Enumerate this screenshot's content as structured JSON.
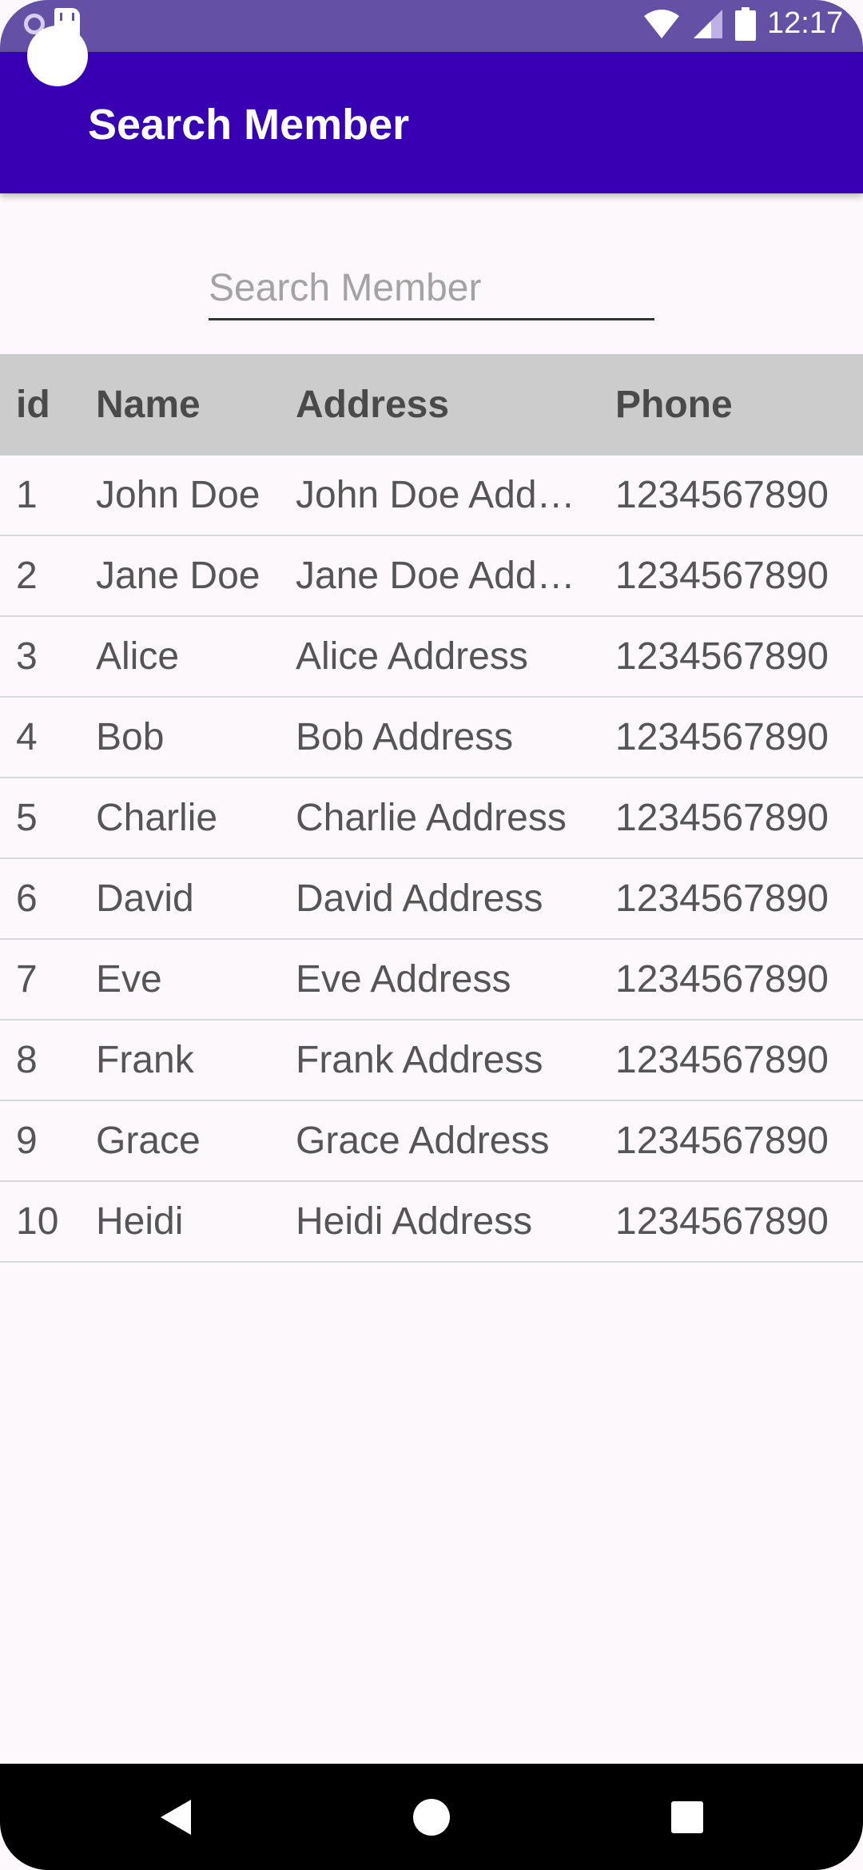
{
  "status_bar": {
    "time": "12:17",
    "icons": [
      "sync-icon",
      "sd-card-icon",
      "wifi-icon",
      "cellular-signal-icon",
      "battery-icon"
    ]
  },
  "app_bar": {
    "title": "Search Member"
  },
  "search": {
    "placeholder": "Search Member",
    "value": ""
  },
  "table": {
    "columns": [
      "id",
      "Name",
      "Address",
      "Phone"
    ],
    "rows": [
      {
        "id": "1",
        "name": "John Doe",
        "address": "John Doe Address",
        "phone": "1234567890"
      },
      {
        "id": "2",
        "name": "Jane Doe",
        "address": "Jane Doe Address",
        "phone": "1234567890"
      },
      {
        "id": "3",
        "name": "Alice",
        "address": "Alice Address",
        "phone": "1234567890"
      },
      {
        "id": "4",
        "name": "Bob",
        "address": "Bob Address",
        "phone": "1234567890"
      },
      {
        "id": "5",
        "name": "Charlie",
        "address": "Charlie Address",
        "phone": "1234567890"
      },
      {
        "id": "6",
        "name": "David",
        "address": "David Address",
        "phone": "1234567890"
      },
      {
        "id": "7",
        "name": "Eve",
        "address": "Eve Address",
        "phone": "1234567890"
      },
      {
        "id": "8",
        "name": "Frank",
        "address": "Frank Address",
        "phone": "1234567890"
      },
      {
        "id": "9",
        "name": "Grace",
        "address": "Grace Address",
        "phone": "1234567890"
      },
      {
        "id": "10",
        "name": "Heidi",
        "address": "Heidi Address",
        "phone": "1234567890"
      }
    ]
  },
  "nav_bar": {
    "buttons": [
      "back-icon",
      "home-icon",
      "recents-icon"
    ]
  },
  "colors": {
    "status_bar": "#6451A5",
    "app_bar": "#3700B3",
    "background": "#FDF8FC",
    "table_header": "#CCCCCC",
    "nav_bar": "#000000"
  }
}
